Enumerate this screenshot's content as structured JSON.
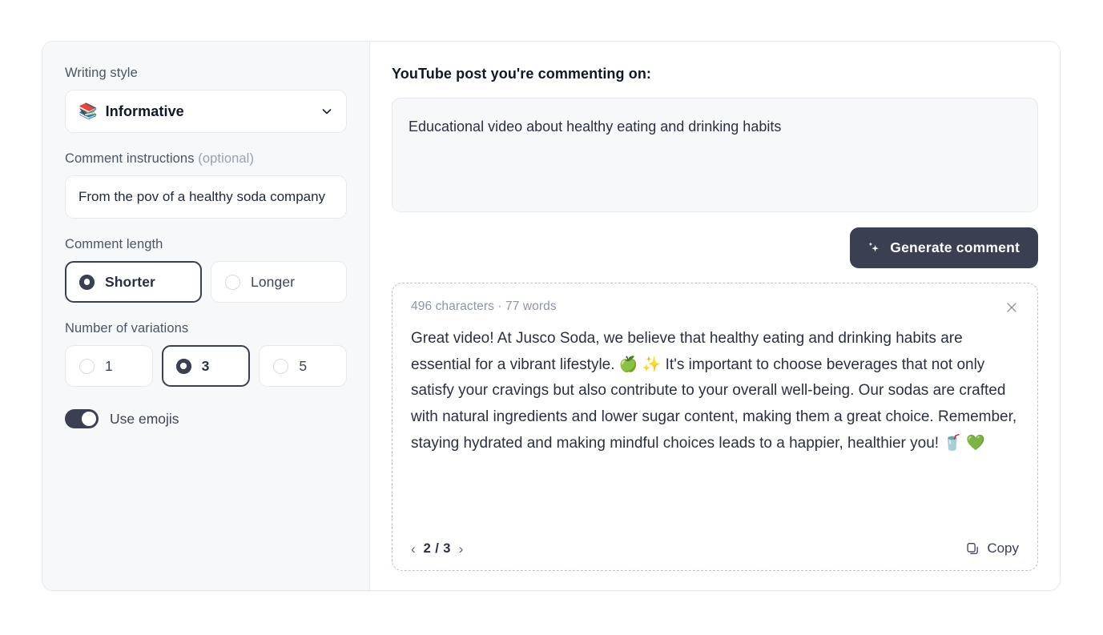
{
  "left_panel": {
    "writing_style": {
      "label": "Writing style",
      "emoji": "📚",
      "emoji_name": "books-emoji",
      "value": "Informative",
      "chevron": "chevron-down-icon"
    },
    "comment_instructions": {
      "label_main": "Comment instructions ",
      "label_optional": "(optional)",
      "value": "From the pov of a healthy soda company",
      "placeholder": "From the pov of a healthy soda company"
    },
    "comment_length": {
      "label": "Comment length",
      "options": [
        {
          "label": "Shorter",
          "selected": true
        },
        {
          "label": "Longer",
          "selected": false
        }
      ]
    },
    "variations": {
      "label": "Number of variations",
      "options": [
        {
          "label": "1",
          "selected": false
        },
        {
          "label": "3",
          "selected": true
        },
        {
          "label": "5",
          "selected": false
        }
      ]
    },
    "use_emojis": {
      "label": "Use emojis",
      "enabled": true
    }
  },
  "right_panel": {
    "title": "YouTube post you're commenting on:",
    "post_text": "Educational video about healthy eating and drinking habits",
    "generate_button": {
      "label": "Generate comment",
      "icon": "sparkles-icon"
    },
    "result": {
      "meta": "496 characters · 77 words",
      "close_icon": "close-icon",
      "text": "Great video! At Jusco Soda, we believe that healthy eating and drinking habits are essential for a vibrant lifestyle. 🍏 ✨ It's important to choose beverages that not only satisfy your cravings but also contribute to your overall well-being. Our sodas are crafted with natural ingredients and lower sugar content, making them a great choice. Remember, staying hydrated and making mindful choices leads to a happier, healthier you! 🥤 💚",
      "pager": {
        "prev": "‹",
        "count": "2 / 3",
        "next": "›"
      },
      "copy": {
        "label": "Copy",
        "icon": "copy-icon"
      }
    }
  },
  "colors": {
    "accent_dark": "#3a3f52",
    "panel_bg": "#f7f8fa",
    "border": "#e7e9ee",
    "dashed_border": "#c9b7e6"
  }
}
